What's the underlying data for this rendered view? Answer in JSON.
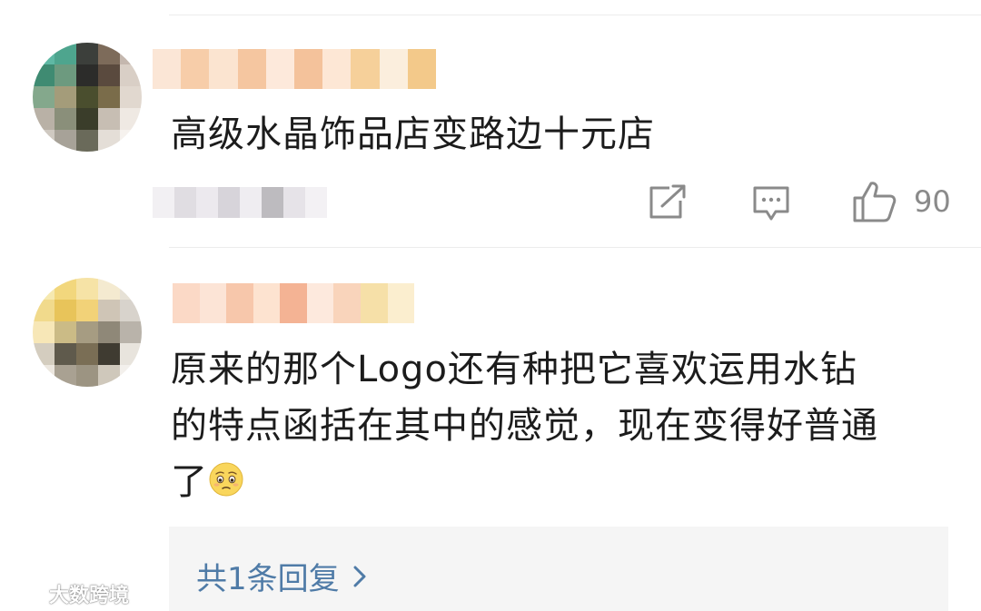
{
  "comments": [
    {
      "text": "高级水晶饰品店变路边十元店",
      "like_count": "90"
    },
    {
      "text_line1": "原来的那个Logo还有种把它喜欢运用水钻",
      "text_line2": "的特点函括在其中的感觉，现在变得好普通",
      "text_line3": "了",
      "emoji": "worried-face",
      "reply_link": "共1条回复"
    }
  ],
  "watermark": {
    "text": "大数跨境"
  },
  "icons": {
    "share": "share-icon",
    "comment": "comment-icon",
    "like": "thumbs-up-icon",
    "chevron": "chevron-right-icon"
  },
  "colors": {
    "text": "#1c1c1c",
    "muted": "#8a8a8a",
    "link": "#4f7ba7",
    "reply_bg": "#f5f5f5"
  }
}
